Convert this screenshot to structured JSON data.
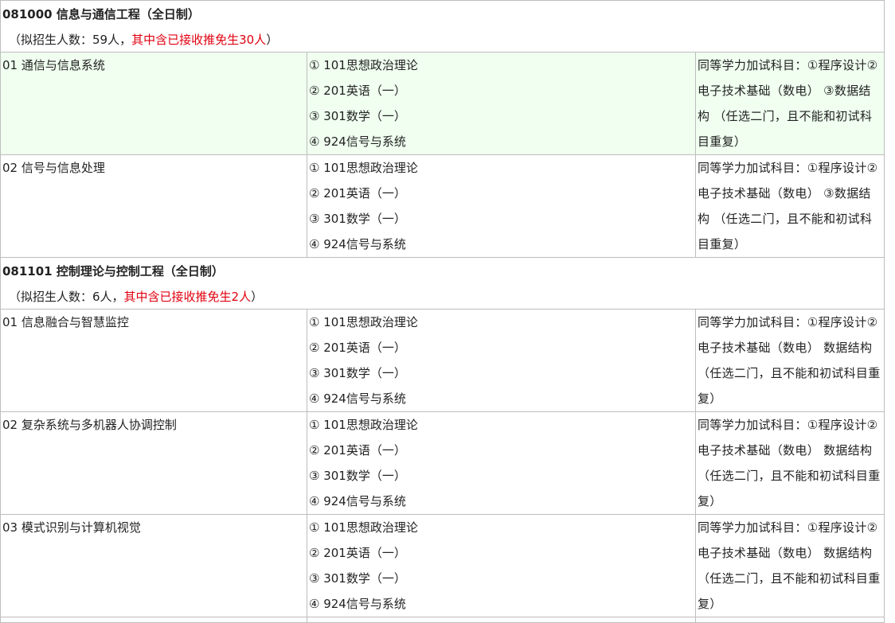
{
  "majors": [
    {
      "title": "081000 信息与通信工程（全日制）",
      "enroll_prefix": "（拟招生人数：59人，",
      "enroll_red": "其中含已接收推免生30人",
      "enroll_suffix": "）",
      "directions": [
        {
          "name": "01 通信与信息系统",
          "subjects": [
            "① 101思想政治理论",
            "② 201英语（一）",
            "③ 301数学（一）",
            "④ 924信号与系统"
          ],
          "note": "同等学力加试科目：①程序设计②电子技术基础（数电） ③数据结构 （任选二门，且不能和初试科目重复）"
        },
        {
          "name": "02 信号与信息处理",
          "subjects": [
            "① 101思想政治理论",
            "② 201英语（一）",
            "③ 301数学（一）",
            "④ 924信号与系统"
          ],
          "note": "同等学力加试科目：①程序设计②电子技术基础（数电） ③数据结构 （任选二门，且不能和初试科目重复）"
        }
      ]
    },
    {
      "title": "081101 控制理论与控制工程（全日制）",
      "enroll_prefix": "（拟招生人数：6人，",
      "enroll_red": "其中含已接收推免生2人",
      "enroll_suffix": "）",
      "directions": [
        {
          "name": "01 信息融合与智慧监控",
          "subjects": [
            "① 101思想政治理论",
            "② 201英语（一）",
            "③ 301数学（一）",
            "④ 924信号与系统"
          ],
          "note": "同等学力加试科目：①程序设计②电子技术基础（数电） 数据结构 （任选二门，且不能和初试科目重复）"
        },
        {
          "name": "02 复杂系统与多机器人协调控制",
          "subjects": [
            "① 101思想政治理论",
            "② 201英语（一）",
            "③ 301数学（一）",
            "④ 924信号与系统"
          ],
          "note": "同等学力加试科目：①程序设计②电子技术基础（数电） 数据结构 （任选二门，且不能和初试科目重复）"
        },
        {
          "name": "03 模式识别与计算机视觉",
          "subjects": [
            "① 101思想政治理论",
            "② 201英语（一）",
            "③ 301数学（一）",
            "④ 924信号与系统"
          ],
          "note": "同等学力加试科目：①程序设计②电子技术基础（数电） 数据结构 （任选二门，且不能和初试科目重复）"
        }
      ]
    }
  ]
}
